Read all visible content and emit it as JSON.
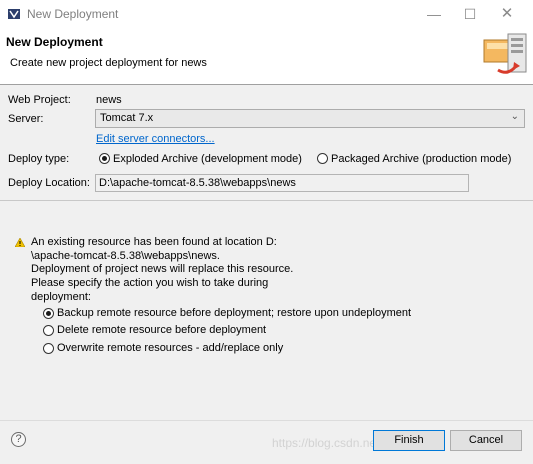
{
  "window": {
    "title": "New Deployment",
    "min_glyph": "—",
    "max_glyph": "☐",
    "close_glyph": "✕"
  },
  "header": {
    "title": "New Deployment",
    "description": "Create new project deployment for news"
  },
  "form": {
    "web_project_label": "Web Project:",
    "web_project_value": "news",
    "server_label": "Server:",
    "server_selected": "Tomcat  7.x",
    "edit_connectors_link": "Edit server connectors...",
    "deploy_type_label": "Deploy type:",
    "deploy_type_options": [
      {
        "label": "Exploded Archive (development mode)",
        "selected": true
      },
      {
        "label": "Packaged Archive (production mode)",
        "selected": false
      }
    ],
    "deploy_location_label": "Deploy Location:",
    "deploy_location_value": "D:\\apache-tomcat-8.5.38\\webapps\\news"
  },
  "warning": {
    "icon": "warning-icon",
    "lines": [
      "An existing resource has been found at location D:",
      "\\apache-tomcat-8.5.38\\webapps\\news.",
      "Deployment of project news will replace this resource.",
      "Please specify the action you wish to take during",
      "deployment:"
    ],
    "options": [
      {
        "label": "Backup remote resource before deployment; restore upon undeployment",
        "selected": true
      },
      {
        "label": "Delete remote resource before deployment",
        "selected": false
      },
      {
        "label": "Overwrite remote resources - add/replace only",
        "selected": false
      }
    ]
  },
  "footer": {
    "help_glyph": "?",
    "finish_label": "Finish",
    "cancel_label": "Cancel",
    "watermark": "https://blog.csdn.net/qq_46351..."
  },
  "colors": {
    "link": "#0066cc",
    "warning": "#f2c200",
    "primary_border": "#0078d7"
  }
}
